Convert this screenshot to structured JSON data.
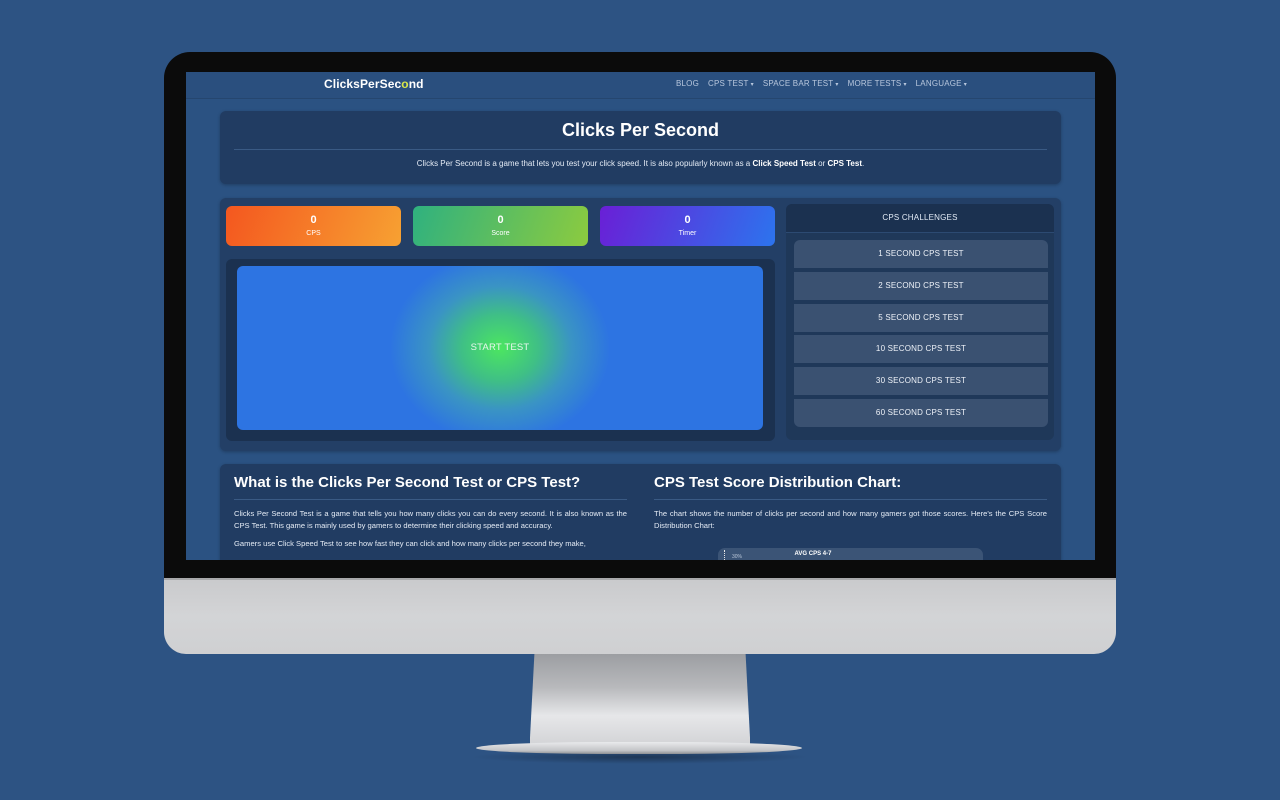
{
  "navbar": {
    "logo_prefix": "ClicksPerSec",
    "logo_o": "o",
    "logo_suffix": "nd",
    "links": [
      {
        "label": "BLOG",
        "dropdown": false
      },
      {
        "label": "CPS TEST",
        "dropdown": true
      },
      {
        "label": "SPACE BAR TEST",
        "dropdown": true
      },
      {
        "label": "MORE TESTS",
        "dropdown": true
      },
      {
        "label": "LANGUAGE",
        "dropdown": true
      }
    ],
    "caret_glyph": "▾"
  },
  "intro": {
    "title": "Clicks Per Second",
    "text_before": "Clicks Per Second is a game that lets you test your click speed. It is also popularly known as a ",
    "bold1": "Click Speed Test",
    "text_mid": " or ",
    "bold2": "CPS Test",
    "text_after": "."
  },
  "stats": [
    {
      "value": "0",
      "label": "CPS"
    },
    {
      "value": "0",
      "label": "Score"
    },
    {
      "value": "0",
      "label": "Timer"
    }
  ],
  "click_area": {
    "label": "START TEST"
  },
  "challenges": {
    "header": "CPS CHALLENGES",
    "items": [
      "1 SECOND CPS TEST",
      "2 SECOND CPS TEST",
      "5 SECOND CPS TEST",
      "10 SECOND CPS TEST",
      "30 SECOND CPS TEST",
      "60 SECOND CPS TEST"
    ]
  },
  "info": {
    "left_title": "What is the Clicks Per Second Test or CPS Test?",
    "left_paragraphs": [
      "Clicks Per Second Test is a game that tells you how many clicks you can do every second. It is also known as the CPS Test. This game is mainly used by gamers to determine their clicking speed and accuracy.",
      "Gamers use Click Speed Test to see how fast they can click and how many clicks per second they make,"
    ],
    "right_title": "CPS Test Score Distribution Chart:",
    "right_paragraph": "The chart shows the number of clicks per second and how many gamers got those scores. Here's the CPS Score Distribution Chart:",
    "chart": {
      "title": "AVG CPS 4-7",
      "top_tick": "30%"
    }
  },
  "colors": {
    "page_bg": "#2d5383",
    "card_bg": "#213c62",
    "cps_gradient": [
      "#f4571f",
      "#f7a132"
    ],
    "score_gradient": [
      "#2fb17f",
      "#8ccb3f"
    ],
    "timer_gradient": [
      "#6a1fd6",
      "#2c74ee"
    ],
    "click_area_center": "#4ce660",
    "click_area_edge": "#2d74e2"
  }
}
